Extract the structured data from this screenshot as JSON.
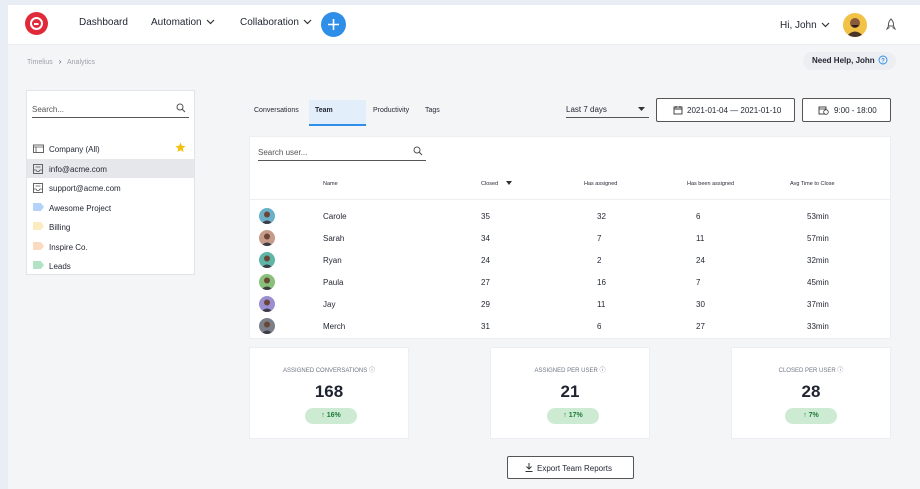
{
  "nav": {
    "items": [
      "Dashboard",
      "Automation",
      "Collaboration"
    ],
    "greeting": "Hi, John"
  },
  "breadcrumb": [
    "Timelius",
    "Analytics"
  ],
  "help_button": "Need Help, John",
  "sidebar": {
    "search_placeholder": "Search...",
    "items": [
      {
        "label": "Company (All)",
        "icon": "building-icon",
        "color": "#555555",
        "starred": true
      },
      {
        "label": "info@acme.com",
        "icon": "inbox-icon",
        "color": "#555555",
        "active": true
      },
      {
        "label": "support@acme.com",
        "icon": "inbox-icon",
        "color": "#555555"
      },
      {
        "label": "Awesome Project",
        "icon": "tag-icon",
        "color": "#2f80ed"
      },
      {
        "label": "Billing",
        "icon": "tag-icon",
        "color": "#f2c94c"
      },
      {
        "label": "Inspire Co.",
        "icon": "tag-icon",
        "color": "#f2994a"
      },
      {
        "label": "Leads",
        "icon": "tag-icon",
        "color": "#27ae60"
      }
    ]
  },
  "tabs": [
    "Conversations",
    "Team",
    "Productivity",
    "Tags"
  ],
  "active_tab": "Team",
  "filters": {
    "range": "Last 7 days",
    "dates": "2021-01-04 — 2021-01-10",
    "time": "9:00 - 18:00"
  },
  "table": {
    "search_placeholder": "Search user...",
    "headers": [
      "Name",
      "Closed",
      "Has assigned",
      "Has been assigned",
      "Avg Time to Close"
    ],
    "rows": [
      {
        "name": "Carole",
        "closed": "35",
        "has_assigned": "32",
        "been_assigned": "6",
        "avg": "53min",
        "avatar_color": "#6ab0c8"
      },
      {
        "name": "Sarah",
        "closed": "34",
        "has_assigned": "7",
        "been_assigned": "11",
        "avg": "57min",
        "avatar_color": "#c79b8a"
      },
      {
        "name": "Ryan",
        "closed": "24",
        "has_assigned": "2",
        "been_assigned": "24",
        "avg": "32min",
        "avatar_color": "#5fb6a8"
      },
      {
        "name": "Paula",
        "closed": "27",
        "has_assigned": "16",
        "been_assigned": "7",
        "avg": "45min",
        "avatar_color": "#88c07a"
      },
      {
        "name": "Jay",
        "closed": "29",
        "has_assigned": "11",
        "been_assigned": "30",
        "avg": "37min",
        "avatar_color": "#9b8fd4"
      },
      {
        "name": "Merch",
        "closed": "31",
        "has_assigned": "6",
        "been_assigned": "27",
        "avg": "33min",
        "avatar_color": "#7a7f8a"
      }
    ]
  },
  "stats": [
    {
      "label": "ASSIGNED CONVERSATIONS",
      "value": "168",
      "change": "16%"
    },
    {
      "label": "ASSIGNED PER USER",
      "value": "21",
      "change": "17%"
    },
    {
      "label": "CLOSED PER USER",
      "value": "28",
      "change": "7%"
    }
  ],
  "export_button": "Export Team Reports",
  "colors": {
    "brand": "#e02a3a",
    "accent": "#2f8ee8",
    "badge_bg": "#cdebd2",
    "badge_text": "#1e7b38"
  }
}
